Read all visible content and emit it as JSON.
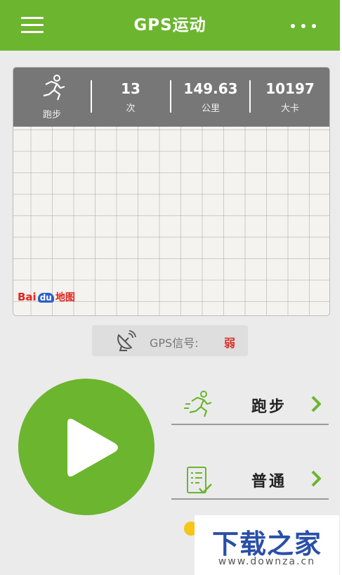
{
  "header": {
    "title": "GPS运动",
    "menu_icon": "hamburger-menu-icon",
    "more_icon": "more-dots-icon"
  },
  "colors": {
    "brand_green": "#6cb52f",
    "stats_bar": "#777777",
    "signal_weak": "#d9332b",
    "baidu_red": "#e1251b",
    "baidu_blue": "#2b5fc9",
    "watermark_blue": "#2a4fa8"
  },
  "stats": {
    "mode_label": "跑步",
    "mode_icon": "runner-icon",
    "count_value": "13",
    "count_label": "次",
    "distance_value": "149.63",
    "distance_label": "公里",
    "calorie_value": "10197",
    "calorie_label": "大卡"
  },
  "map": {
    "logo_bai": "Bai",
    "logo_du": "du",
    "logo_map": "地图"
  },
  "gps": {
    "label": "GPS信号:",
    "value": "弱",
    "icon": "satellite-dish-icon"
  },
  "play": {
    "icon": "play-icon"
  },
  "options": [
    {
      "label": "跑步",
      "icon": "runner-icon"
    },
    {
      "label": "普通",
      "icon": "checklist-icon"
    }
  ],
  "watermark": {
    "title": "下载之家",
    "url": "www.downza.cn"
  }
}
